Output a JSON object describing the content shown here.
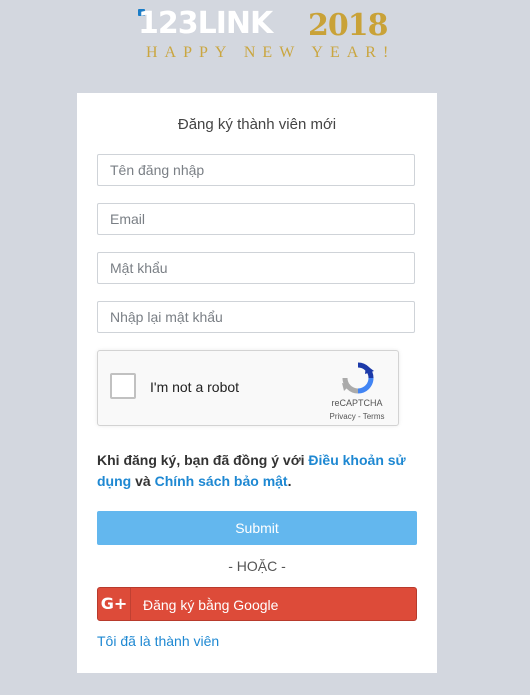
{
  "logo": {
    "brand": "123LINK",
    "year": "2018",
    "tagline": "HAPPY NEW YEAR!"
  },
  "form": {
    "title": "Đăng ký thành viên mới",
    "username_placeholder": "Tên đăng nhập",
    "email_placeholder": "Email",
    "password_placeholder": "Mật khẩu",
    "confirm_placeholder": "Nhập lại mật khẩu"
  },
  "captcha": {
    "label": "I'm not a robot",
    "brand": "reCAPTCHA",
    "privacy": "Privacy",
    "separator": " - ",
    "terms": "Terms"
  },
  "terms": {
    "prefix": "Khi đăng ký, bạn đã đồng ý với ",
    "terms_link": "Điều khoản sử dụng",
    "middle": " và ",
    "privacy_link": "Chính sách bảo mật",
    "suffix": "."
  },
  "actions": {
    "submit": "Submit",
    "or": "- HOẶC -",
    "google_icon": "G+",
    "google": "Đăng ký bằng Google",
    "member_link": "Tôi đã là thành viên"
  },
  "colors": {
    "page_bg": "#d3d7df",
    "submit_bg": "#63b7ee",
    "google_bg": "#dd4b39",
    "link": "#1e88d2",
    "gold": "#c9a238"
  }
}
